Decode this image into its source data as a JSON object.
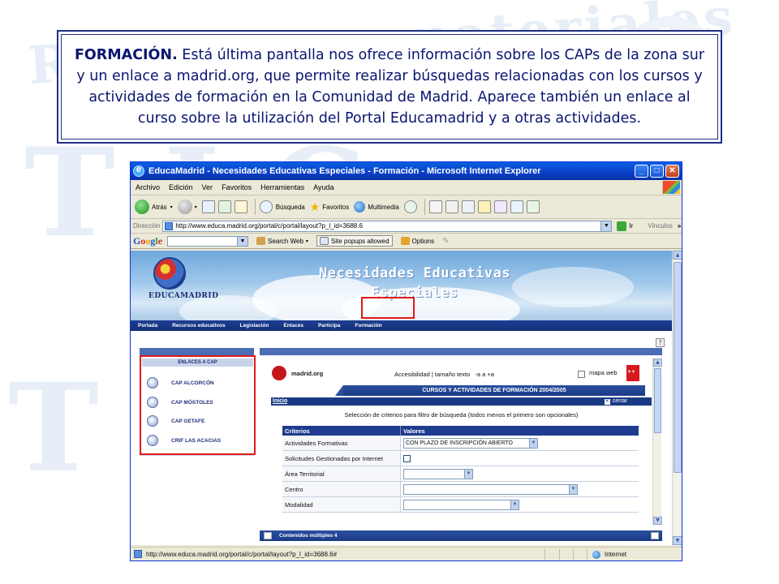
{
  "caption": {
    "lead": "FORMACIÓN.",
    "body": " Está última pantalla nos ofrece información sobre los CAPs de la zona sur y un enlace a madrid.org, que permite realizar búsquedas relacionadas con los cursos y actividades de formación en la Comunidad de Madrid. Aparece también un enlace al curso sobre la utilización del Portal Educamadrid y a otras actividades."
  },
  "window": {
    "title": "EducaMadrid - Necesidades Educativas Especiales - Formación - Microsoft Internet Explorer",
    "controls": {
      "minimize": "_",
      "maximize": "□",
      "close": "✕"
    }
  },
  "menu": [
    "Archivo",
    "Edición",
    "Ver",
    "Favoritos",
    "Herramientas",
    "Ayuda"
  ],
  "toolbar": {
    "back": "Atrás",
    "search": "Búsqueda",
    "favorites": "Favoritos",
    "multimedia": "Multimedia"
  },
  "address": {
    "label": "Dirección",
    "url": "http://www.educa.madrid.org/portal/c/portal/layout?p_l_id=3688.6",
    "go": "Ir",
    "links": "Vínculos"
  },
  "googlebar": {
    "search_web": "Search Web",
    "popups": "Site popups allowed",
    "options": "Options"
  },
  "banner": {
    "logo": "EDUCAMADRID",
    "title_line1": "Necesidades Educativas",
    "title_line2": "Especiales"
  },
  "nav": [
    "Portada",
    "Recursos educativos",
    "Legislación",
    "Enlaces",
    "Participa",
    "Formación"
  ],
  "sidebar": {
    "heading": "ENLACES A CAP",
    "items": [
      "CAP ALCORCÓN",
      "CAP MÓSTOLES",
      "CAP GETAFE",
      "CRIF LAS ACACIAS"
    ]
  },
  "portlet": {
    "madrid_org": "madrid.org",
    "accessibility": "Accesibilidad | tamaño texto",
    "text_sizes": "-a  a  +a",
    "site_map": "mapa web",
    "course_title": "CURSOS Y ACTIVIDADES DE FORMACIÓN 2004/2005",
    "start_link": "Inicio",
    "close": "cerrar",
    "instructions": "Selección de criterios para filtro de búsqueda (todos menos el primero son opcionales)",
    "table": {
      "col1": "Criterios",
      "col2": "Valores",
      "rows": [
        {
          "label": "Actividades Formativas",
          "value": "CON PLAZO DE INSCRIPCIÓN ABIERTO"
        },
        {
          "label": "Solicitudes Gestionadas por Internet",
          "value": ""
        },
        {
          "label": "Área Territorial",
          "value": ""
        },
        {
          "label": "Centro",
          "value": ""
        },
        {
          "label": "Modalidad",
          "value": ""
        }
      ]
    },
    "multi": "Contenidos múltiples 4"
  },
  "status": {
    "url": "http://www.educa.madrid.org/portal/c/portal/layout?p_l_id=3688.6#",
    "zone": "Internet"
  },
  "colors": {
    "caption_text": "#0a1670",
    "caption_border": "#1f2f86",
    "highlight": "#e21a1a",
    "nav_blue": "#1d3f93"
  }
}
